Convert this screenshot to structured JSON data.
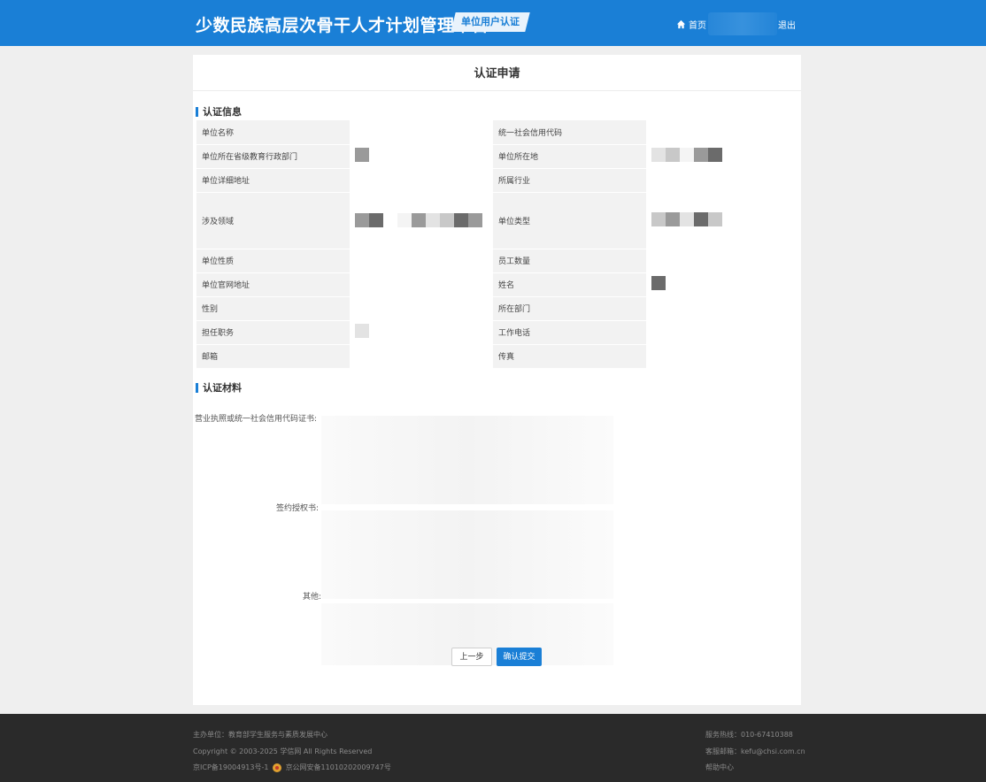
{
  "header": {
    "title": "少数民族高层次骨干人才计划管理平台",
    "badge": "单位用户认证",
    "home_label": "首页",
    "logout_label": "退出"
  },
  "page_title": "认证申请",
  "info_section": {
    "heading": "认证信息",
    "rows": [
      {
        "left_label": "单位名称",
        "right_label": "统一社会信用代码"
      },
      {
        "left_label": "单位所在省级教育行政部门",
        "right_label": "单位所在地"
      },
      {
        "left_label": "单位详细地址",
        "right_label": "所属行业"
      },
      {
        "left_label": "涉及领域",
        "right_label": "单位类型"
      },
      {
        "left_label": "单位性质",
        "right_label": "员工数量"
      },
      {
        "left_label": "单位官网地址",
        "right_label": "姓名"
      },
      {
        "left_label": "性别",
        "right_label": "所在部门"
      },
      {
        "left_label": "担任职务",
        "right_label": "工作电话"
      },
      {
        "left_label": "邮箱",
        "right_label": "传真"
      }
    ]
  },
  "materials_section": {
    "heading": "认证材料",
    "items": [
      {
        "label": "营业执照或统一社会信用代码证书:"
      },
      {
        "label": "签约授权书:"
      },
      {
        "label": "其他:"
      }
    ]
  },
  "buttons": {
    "prev": "上一步",
    "submit": "确认提交"
  },
  "footer": {
    "organizer": "主办单位：教育部学生服务与素质发展中心",
    "copyright": "Copyright © 2003-2025 学信网 All Rights Reserved",
    "icp": "京ICP备19004913号-1",
    "police": "京公网安备11010202009747号",
    "hotline": "服务热线：010-67410388",
    "email": "客服邮箱：kefu@chsi.com.cn",
    "help": "帮助中心"
  },
  "colors": {
    "brand_blue": "#1a7fd6",
    "footer_bg": "#2a2a2a",
    "page_bg": "#efefef"
  }
}
